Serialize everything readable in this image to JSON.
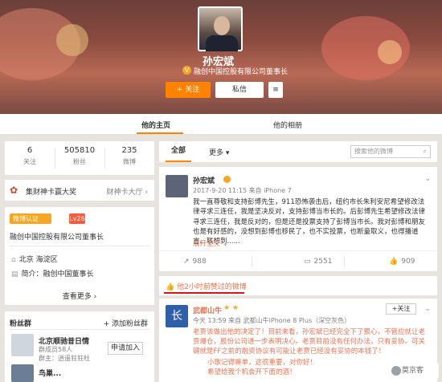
{
  "profile": {
    "name": "孙宏斌",
    "title": "融创中国控股有限公司董事长",
    "follow_label": "+ 关注",
    "message_label": "私信",
    "more_label": "≡"
  },
  "tabs": {
    "home": "他的主页",
    "album": "他的相册"
  },
  "stats": [
    {
      "value": "6",
      "label": "关注"
    },
    {
      "value": "505810",
      "label": "粉丝"
    },
    {
      "value": "235",
      "label": "微博"
    }
  ],
  "award": {
    "text": "集财神卡赢大奖",
    "link": "财神卡大厅 ›"
  },
  "info": {
    "verified_tag": "微博认证",
    "level": "Lv26",
    "description": "融创中国控股有限公司董事长",
    "location": "北京 海淀区",
    "intro": "简介：融创中国董事长",
    "more": "查看更多 ›"
  },
  "fans": {
    "header": "粉丝群",
    "create": "+ 添加粉丝群",
    "group1_name": "北京顺驰昔日情",
    "group1_sub": "群成员58人",
    "group1_sub2": "群主：逍遥狂狂杜",
    "join_label": "申请加入",
    "group2_name": "鸟巢..."
  },
  "filter": {
    "all": "全部",
    "more": "更多 ▾",
    "search_placeholder": "搜索他的微博"
  },
  "post1": {
    "name": "孙宏斌",
    "meta": "2017-9-20 11:15 来自 iPhone 7",
    "body": "我一直尊敬和支持彭博先生，911恐怖袭击后，纽约市长朱利安尼希望修改法律寻求三连任，我是坚决反对，支持彭博当市长的。后彭博先生希望修改法律寻求三连任，我是反对的，但是还是投票支持了彭博当市长。我对彭博和朋友也是有好感的，没想到彭博也移民了，也不实投票，也断童取义，也得播道言。联想到......",
    "expand": "展开全文 ⌄",
    "forward": "988",
    "comment": "2551",
    "like": "909"
  },
  "tip": {
    "text": "他2小时前赞过的微博"
  },
  "post2": {
    "name": "武都山牛",
    "meta": "今天 13:59 来自 武都山牛iPhone 8 Plus（深空灰色）",
    "follow": "+关注",
    "body": "老贾该做出他的决定了！目前来看，孙宏斌已经完全下了狠心，不管应就让老贾爆仓，股份公司进一步表明决心。老贾目前没有任何办法，只有妥协。可关键就是FF之前的融资协议有可能让老贾已经没有妥协的本钱了！",
    "sub1": "小歌记得嘛单，这很重要，对你好！",
    "sub2": "希望给我个机会开下面的酒！"
  },
  "watermark": "莫京客"
}
